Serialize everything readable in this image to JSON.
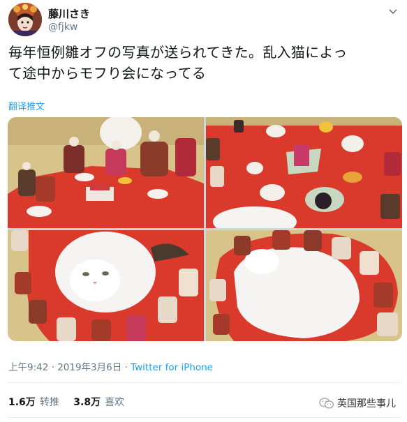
{
  "author": {
    "display_name": "藤川さき",
    "handle": "@fjkw"
  },
  "tweet": {
    "text_line1": "毎年恒例雛オフの写真が送られてきた。乱入猫によっ",
    "text_line2": "て途中からモフり会になってる",
    "translate_label": "翻译推文"
  },
  "meta": {
    "time": "上午9:42",
    "separator": " · ",
    "date": "2019年3月6日",
    "source": "Twitter for iPhone"
  },
  "stats": {
    "retweets_count": "1.6万",
    "retweets_label": "转推",
    "likes_count": "3.8万",
    "likes_label": "喜欢"
  },
  "watermark": {
    "text": "英国那些事儿"
  },
  "colors": {
    "link": "#1da1f2",
    "secondary_text": "#657786",
    "primary_text": "#14171a",
    "red_felt": "#d93a2c"
  },
  "media": {
    "photo_count": 4
  }
}
